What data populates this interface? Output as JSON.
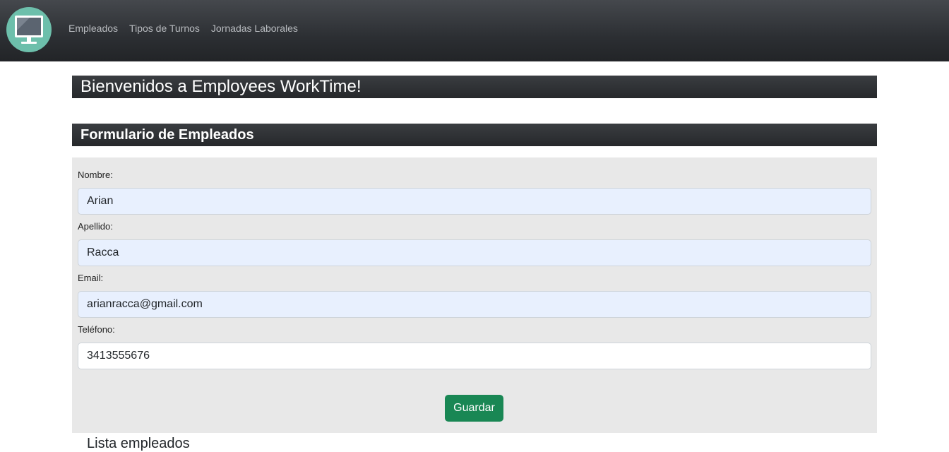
{
  "nav": {
    "logo_icon": "monitor-icon",
    "items": [
      {
        "label": "Empleados"
      },
      {
        "label": "Tipos de Turnos"
      },
      {
        "label": "Jornadas Laborales"
      }
    ]
  },
  "welcome": {
    "title": "Bienvenidos a Employees WorkTime!"
  },
  "form": {
    "title": "Formulario de Empleados",
    "fields": [
      {
        "label": "Nombre:",
        "value": "Arian"
      },
      {
        "label": "Apellido:",
        "value": "Racca"
      },
      {
        "label": "Email:",
        "value": "arianracca@gmail.com"
      },
      {
        "label": "Teléfono:",
        "value": "3413555676"
      }
    ],
    "save_label": "Guardar"
  },
  "list": {
    "title": "Lista empleados"
  },
  "colors": {
    "navbar": "#2c2f33",
    "logo_bg": "#6dbfab",
    "save_button": "#198754",
    "panel_bg": "#e8e8e8",
    "autofill_bg": "#e8f0fe"
  }
}
